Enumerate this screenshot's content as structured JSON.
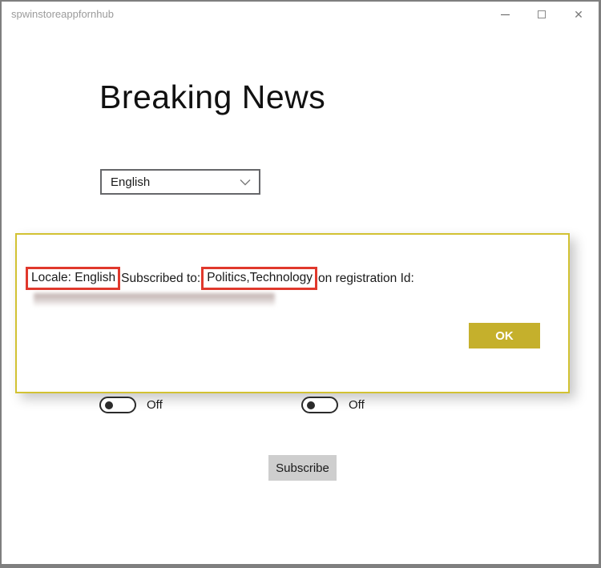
{
  "window": {
    "title": "spwinstoreappfornhub",
    "controls": {
      "minimize": "minimize-icon",
      "maximize": "maximize-icon",
      "close": "close-icon"
    }
  },
  "icons": {
    "close_glyph": "✕",
    "chevron": "chevron-down-icon"
  },
  "main": {
    "heading": "Breaking News",
    "language_select": {
      "value": "English"
    },
    "toggles": [
      {
        "label": "Off",
        "state": "off"
      },
      {
        "label": "Off",
        "state": "off"
      }
    ],
    "subscribe_button": "Subscribe"
  },
  "dialog": {
    "segments": {
      "locale": "Locale: English",
      "subscribed": "Subscribed to:",
      "topics": "Politics,Technology",
      "registration": "on registration Id:"
    },
    "registration_id_redacted": true,
    "ok_button": "OK"
  },
  "colors": {
    "window_border": "#7f7f7f",
    "title_text": "#9b9b9b",
    "dialog_border": "#d2c233",
    "annotation_red": "#e0382c",
    "ok_button_bg": "#c5b02c",
    "subscribe_bg": "#cecece"
  }
}
